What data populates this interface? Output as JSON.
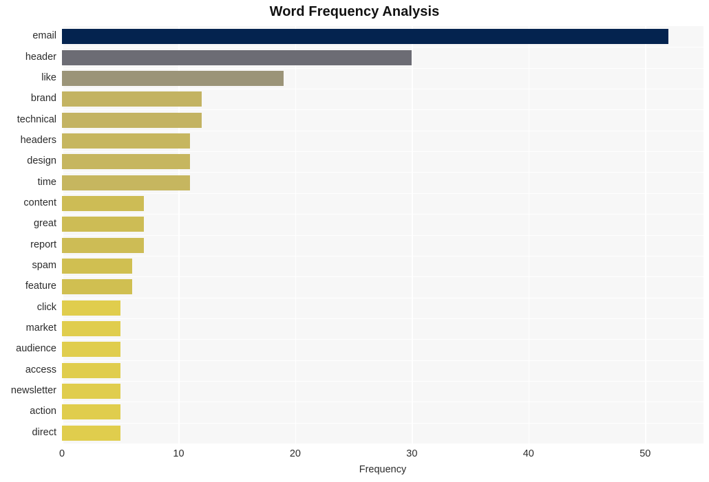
{
  "chart_data": {
    "type": "bar",
    "orientation": "horizontal",
    "title": "Word Frequency Analysis",
    "xlabel": "Frequency",
    "ylabel": "",
    "xlim": [
      0,
      55
    ],
    "ylim": [
      0,
      20
    ],
    "grid": true,
    "legend": null,
    "xticks": [
      "0",
      "10",
      "20",
      "30",
      "40",
      "50"
    ],
    "xtick_values": [
      0,
      10,
      20,
      30,
      40,
      50
    ],
    "categories": [
      "email",
      "header",
      "like",
      "brand",
      "technical",
      "headers",
      "design",
      "time",
      "content",
      "great",
      "report",
      "spam",
      "feature",
      "click",
      "market",
      "audience",
      "access",
      "newsletter",
      "action",
      "direct"
    ],
    "values": [
      52,
      30,
      19,
      12,
      12,
      11,
      11,
      11,
      7,
      7,
      7,
      6,
      6,
      5,
      5,
      5,
      5,
      5,
      5,
      5
    ],
    "bar_colors": [
      "#04234f",
      "#6c6c74",
      "#9b9478",
      "#c3b362",
      "#c3b362",
      "#c6b65f",
      "#c6b65f",
      "#c6b65f",
      "#cdbc55",
      "#cdbc55",
      "#cdbc55",
      "#d0bf51",
      "#d0bf51",
      "#e0cd4d",
      "#e0cd4d",
      "#e0cd4d",
      "#e0cd4d",
      "#e0cd4d",
      "#e0cd4d",
      "#e0cd4d"
    ],
    "plot_background": "#f7f7f7",
    "grid_color": "#ffffff",
    "figure_background": "#ffffff",
    "text_color": "#2b2b2b",
    "title_color": "#111111"
  }
}
